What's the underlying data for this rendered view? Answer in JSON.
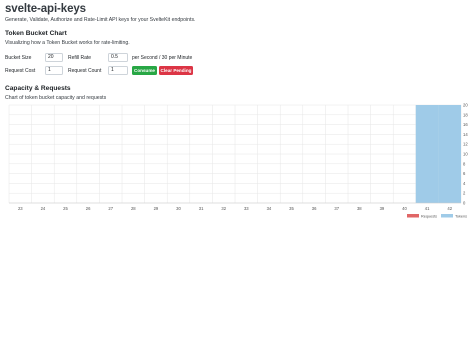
{
  "header": {
    "title": "svelte-api-keys",
    "subtitle": "Generate, Validate, Authorize and Rate-Limit API keys for your SvelteKit endpoints."
  },
  "bucket_section": {
    "title": "Token Bucket Chart",
    "description": "Visualizing how a Token Bucket works for rate-limiting.",
    "bucket_size": {
      "label": "Bucket Size",
      "value": "20"
    },
    "refill_rate": {
      "label": "Refill Rate",
      "value": "0.5",
      "unit": "per Second / 30 per Minute"
    },
    "request_cost": {
      "label": "Request Cost",
      "value": "1"
    },
    "request_count": {
      "label": "Request Count",
      "value": "1"
    },
    "consume_label": "Consume",
    "clear_label": "Clear Pending"
  },
  "capacity_section": {
    "title": "Capacity & Requests",
    "description": "Chart of token bucket capacity and requests"
  },
  "colors": {
    "requests": "#e06666",
    "tokens": "#9fcbe8",
    "consume": "#28a745",
    "clear": "#dc3545"
  },
  "chart_data": {
    "type": "bar",
    "categories": [
      "23",
      "24",
      "25",
      "26",
      "27",
      "28",
      "29",
      "30",
      "31",
      "32",
      "33",
      "34",
      "35",
      "36",
      "37",
      "38",
      "39",
      "40",
      "41",
      "42"
    ],
    "series": [
      {
        "name": "Requests",
        "values": [
          0,
          0,
          0,
          0,
          0,
          0,
          0,
          0,
          0,
          0,
          0,
          0,
          0,
          0,
          0,
          0,
          0,
          0,
          0,
          0
        ]
      },
      {
        "name": "Tokens",
        "values": [
          0,
          0,
          0,
          0,
          0,
          0,
          0,
          0,
          0,
          0,
          0,
          0,
          0,
          0,
          0,
          0,
          0,
          0,
          20,
          20
        ]
      }
    ],
    "yticks": [
      0,
      2,
      4,
      6,
      8,
      10,
      12,
      14,
      16,
      18,
      20
    ],
    "ylim": [
      0,
      20
    ],
    "y_axis_position": "right",
    "stacked": true,
    "grid": true,
    "legend_position": "bottom-right"
  }
}
